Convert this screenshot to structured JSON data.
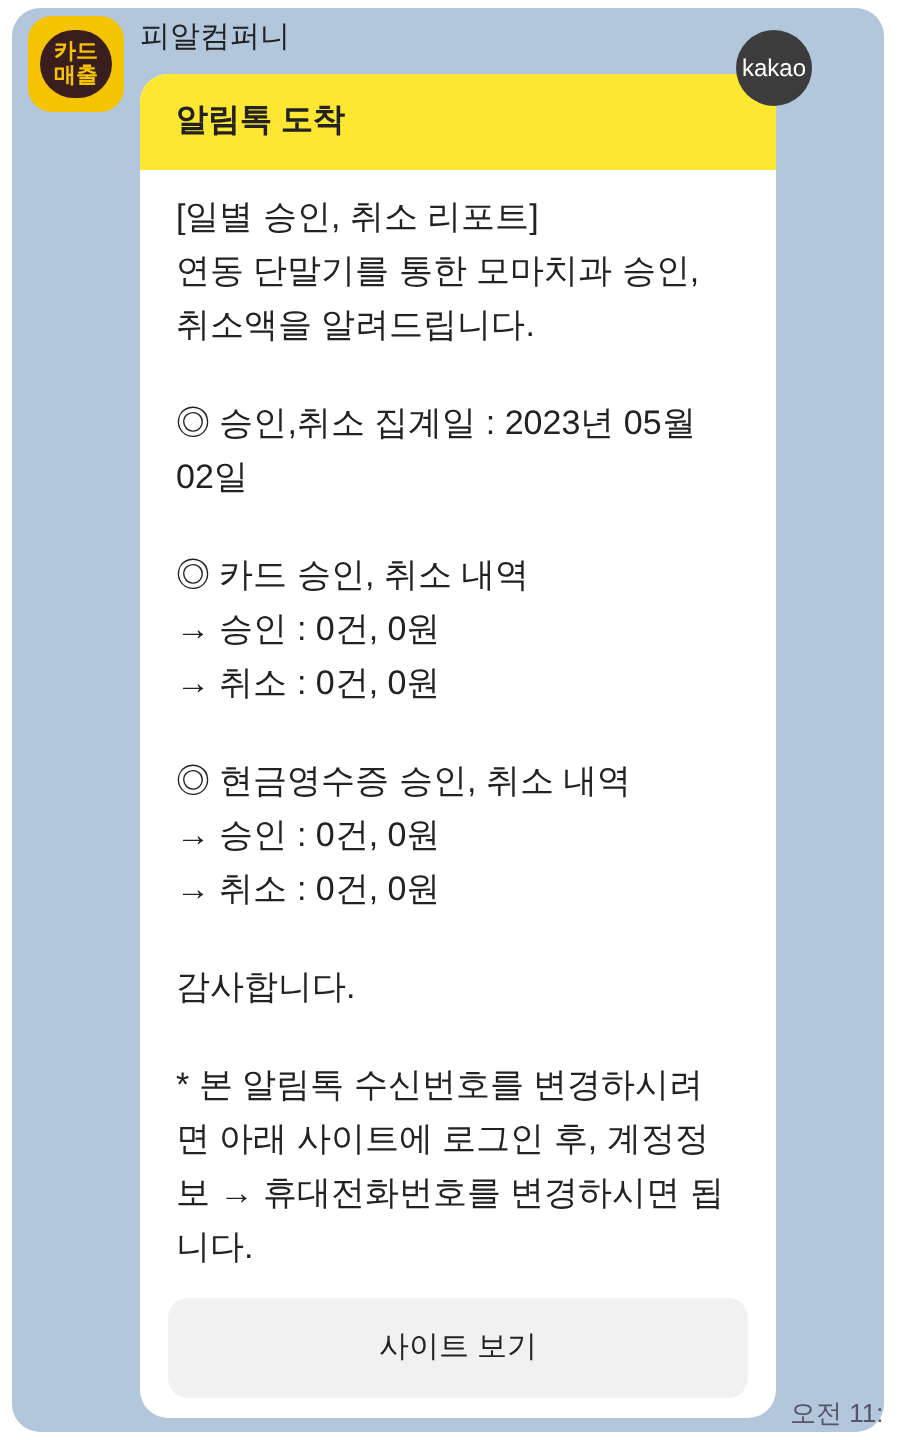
{
  "sender": {
    "avatar_lines": [
      "카드",
      "매출"
    ],
    "name": "피알컴퍼니"
  },
  "badge": "kakao",
  "message": {
    "header": "알림톡 도착",
    "paragraphs": [
      [
        "[일별 승인, 취소 리포트]",
        "연동 단말기를 통한 모마치과 승인,",
        "취소액을 알려드립니다."
      ],
      [
        "◎ 승인,취소 집계일 : 2023년 05월",
        "02일"
      ],
      [
        "◎ 카드 승인, 취소 내역",
        "→ 승인 : 0건, 0원",
        "→ 취소 : 0건, 0원"
      ],
      [
        "◎ 현금영수증 승인, 취소 내역",
        "→ 승인 : 0건, 0원",
        "→ 취소 : 0건, 0원"
      ],
      [
        "감사합니다."
      ],
      [
        "* 본 알림톡 수신번호를 변경하시려",
        "면 아래 사이트에 로그인 후, 계정정",
        "보 → 휴대전화번호를 변경하시면 됩",
        "니다."
      ]
    ],
    "button": "사이트 보기"
  },
  "time": "오전 11:"
}
